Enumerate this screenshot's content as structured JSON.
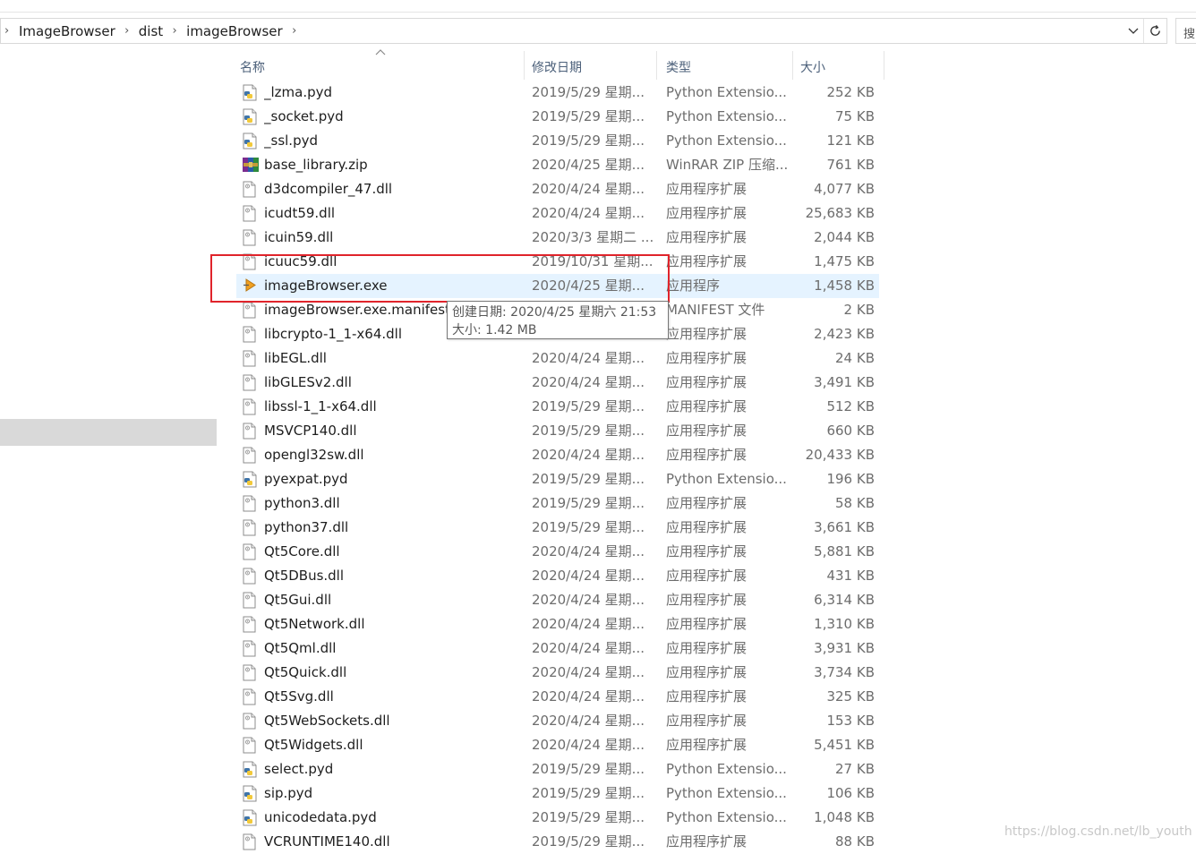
{
  "breadcrumbs": [
    "ImageBrowser",
    "dist",
    "imageBrowser"
  ],
  "search": {
    "placeholder": "搜"
  },
  "columns": {
    "name": "名称",
    "date": "修改日期",
    "type": "类型",
    "size": "大小"
  },
  "files": [
    {
      "name": "_lzma.pyd",
      "date": "2019/5/29 星期...",
      "type": "Python Extensio...",
      "size": "252 KB",
      "icon": "python-file-icon"
    },
    {
      "name": "_socket.pyd",
      "date": "2019/5/29 星期...",
      "type": "Python Extensio...",
      "size": "75 KB",
      "icon": "python-file-icon"
    },
    {
      "name": "_ssl.pyd",
      "date": "2019/5/29 星期...",
      "type": "Python Extensio...",
      "size": "121 KB",
      "icon": "python-file-icon"
    },
    {
      "name": "base_library.zip",
      "date": "2020/4/25 星期...",
      "type": "WinRAR ZIP 压缩...",
      "size": "761 KB",
      "icon": "winrar-archive-icon"
    },
    {
      "name": "d3dcompiler_47.dll",
      "date": "2020/4/24 星期...",
      "type": "应用程序扩展",
      "size": "4,077 KB",
      "icon": "dll-file-icon"
    },
    {
      "name": "icudt59.dll",
      "date": "2020/4/24 星期...",
      "type": "应用程序扩展",
      "size": "25,683 KB",
      "icon": "dll-file-icon"
    },
    {
      "name": "icuin59.dll",
      "date": "2020/3/3 星期二 ...",
      "type": "应用程序扩展",
      "size": "2,044 KB",
      "icon": "dll-file-icon"
    },
    {
      "name": "icuuc59.dll",
      "date": "2019/10/31 星期...",
      "type": "应用程序扩展",
      "size": "1,475 KB",
      "icon": "dll-file-icon"
    },
    {
      "name": "imageBrowser.exe",
      "date": "2020/4/25 星期...",
      "type": "应用程序",
      "size": "1,458 KB",
      "icon": "executable-icon",
      "selected": true
    },
    {
      "name": "imageBrowser.exe.manifest",
      "date": "",
      "type": "MANIFEST 文件",
      "size": "2 KB",
      "icon": "manifest-file-icon"
    },
    {
      "name": "libcrypto-1_1-x64.dll",
      "date": "",
      "type": "应用程序扩展",
      "size": "2,423 KB",
      "icon": "dll-file-icon"
    },
    {
      "name": "libEGL.dll",
      "date": "2020/4/24 星期...",
      "type": "应用程序扩展",
      "size": "24 KB",
      "icon": "dll-file-icon"
    },
    {
      "name": "libGLESv2.dll",
      "date": "2020/4/24 星期...",
      "type": "应用程序扩展",
      "size": "3,491 KB",
      "icon": "dll-file-icon"
    },
    {
      "name": "libssl-1_1-x64.dll",
      "date": "2019/5/29 星期...",
      "type": "应用程序扩展",
      "size": "512 KB",
      "icon": "dll-file-icon"
    },
    {
      "name": "MSVCP140.dll",
      "date": "2019/5/29 星期...",
      "type": "应用程序扩展",
      "size": "660 KB",
      "icon": "dll-file-icon"
    },
    {
      "name": "opengl32sw.dll",
      "date": "2020/4/24 星期...",
      "type": "应用程序扩展",
      "size": "20,433 KB",
      "icon": "dll-file-icon"
    },
    {
      "name": "pyexpat.pyd",
      "date": "2019/5/29 星期...",
      "type": "Python Extensio...",
      "size": "196 KB",
      "icon": "python-file-icon"
    },
    {
      "name": "python3.dll",
      "date": "2019/5/29 星期...",
      "type": "应用程序扩展",
      "size": "58 KB",
      "icon": "dll-file-icon"
    },
    {
      "name": "python37.dll",
      "date": "2019/5/29 星期...",
      "type": "应用程序扩展",
      "size": "3,661 KB",
      "icon": "dll-file-icon"
    },
    {
      "name": "Qt5Core.dll",
      "date": "2020/4/24 星期...",
      "type": "应用程序扩展",
      "size": "5,881 KB",
      "icon": "dll-file-icon"
    },
    {
      "name": "Qt5DBus.dll",
      "date": "2020/4/24 星期...",
      "type": "应用程序扩展",
      "size": "431 KB",
      "icon": "dll-file-icon"
    },
    {
      "name": "Qt5Gui.dll",
      "date": "2020/4/24 星期...",
      "type": "应用程序扩展",
      "size": "6,314 KB",
      "icon": "dll-file-icon"
    },
    {
      "name": "Qt5Network.dll",
      "date": "2020/4/24 星期...",
      "type": "应用程序扩展",
      "size": "1,310 KB",
      "icon": "dll-file-icon"
    },
    {
      "name": "Qt5Qml.dll",
      "date": "2020/4/24 星期...",
      "type": "应用程序扩展",
      "size": "3,931 KB",
      "icon": "dll-file-icon"
    },
    {
      "name": "Qt5Quick.dll",
      "date": "2020/4/24 星期...",
      "type": "应用程序扩展",
      "size": "3,734 KB",
      "icon": "dll-file-icon"
    },
    {
      "name": "Qt5Svg.dll",
      "date": "2020/4/24 星期...",
      "type": "应用程序扩展",
      "size": "325 KB",
      "icon": "dll-file-icon"
    },
    {
      "name": "Qt5WebSockets.dll",
      "date": "2020/4/24 星期...",
      "type": "应用程序扩展",
      "size": "153 KB",
      "icon": "dll-file-icon"
    },
    {
      "name": "Qt5Widgets.dll",
      "date": "2020/4/24 星期...",
      "type": "应用程序扩展",
      "size": "5,451 KB",
      "icon": "dll-file-icon"
    },
    {
      "name": "select.pyd",
      "date": "2019/5/29 星期...",
      "type": "Python Extensio...",
      "size": "27 KB",
      "icon": "python-file-icon"
    },
    {
      "name": "sip.pyd",
      "date": "2019/5/29 星期...",
      "type": "Python Extensio...",
      "size": "106 KB",
      "icon": "python-file-icon"
    },
    {
      "name": "unicodedata.pyd",
      "date": "2019/5/29 星期...",
      "type": "Python Extensio...",
      "size": "1,048 KB",
      "icon": "python-file-icon"
    },
    {
      "name": "VCRUNTIME140.dll",
      "date": "2019/5/29 星期...",
      "type": "应用程序扩展",
      "size": "88 KB",
      "icon": "dll-file-icon"
    }
  ],
  "tooltip": {
    "created": "创建日期: 2020/4/25 星期六 21:53",
    "size": "大小: 1.42 MB"
  },
  "watermark": "https://blog.csdn.net/lb_youth",
  "colors": {
    "selection": "#e5f3ff",
    "highlight_box": "#e0242b",
    "header_text": "#4c607a",
    "nav_selected": "#d9d9d9"
  }
}
